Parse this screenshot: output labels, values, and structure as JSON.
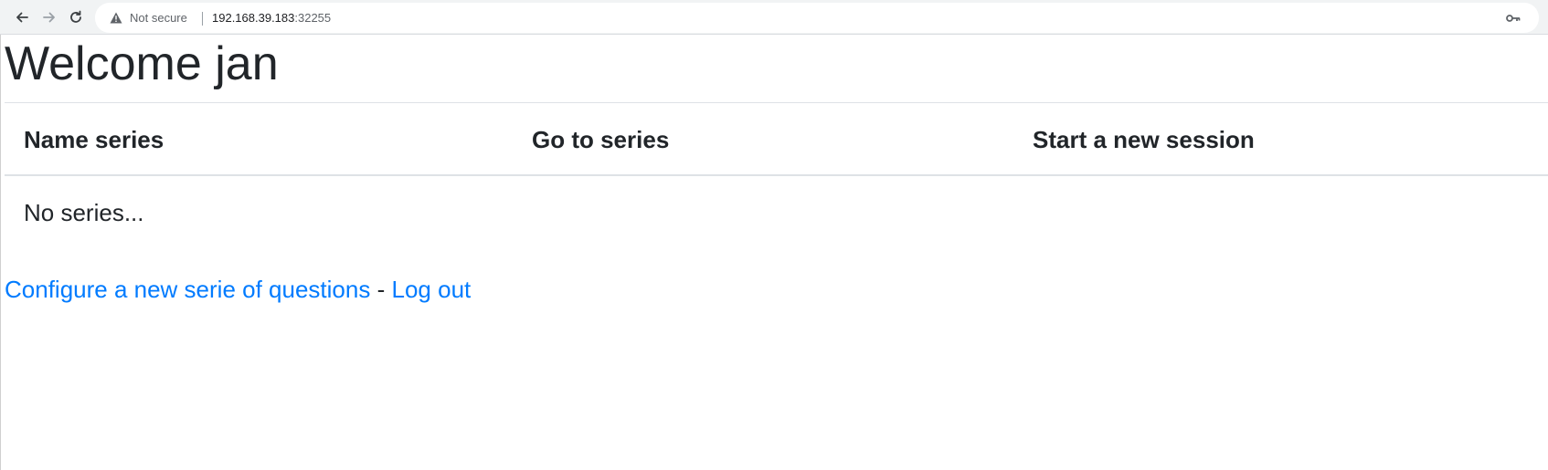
{
  "browser": {
    "security_label": "Not secure",
    "url_host": "192.168.39.183",
    "url_port": ":32255",
    "icons": {
      "back": "back-arrow-icon",
      "forward": "forward-arrow-icon",
      "reload": "reload-icon",
      "warning": "warning-triangle-icon",
      "key": "key-icon"
    }
  },
  "page": {
    "title": "Welcome jan",
    "table": {
      "headers": [
        "Name series",
        "Go to series",
        "Start a new session"
      ],
      "empty_message": "No series..."
    },
    "links": {
      "configure": "Configure a new serie of questions",
      "separator": "-",
      "logout": "Log out"
    }
  },
  "colors": {
    "link": "#007bff",
    "text": "#212529",
    "toolbar_bg": "#f1f3f4"
  }
}
